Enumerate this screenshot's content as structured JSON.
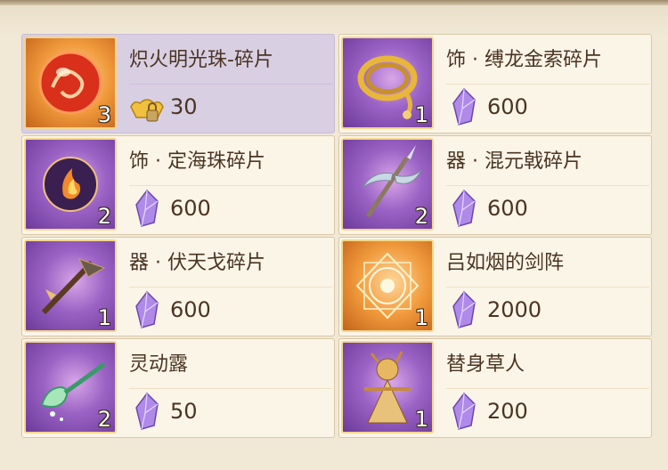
{
  "items": [
    {
      "name": "炽火明光珠-碎片",
      "quantity": "3",
      "price": "30",
      "currency_icon": "gold-ingot-lock-icon",
      "item_icon": "fire-orb-icon",
      "frame": "orange",
      "selected": true
    },
    {
      "name": "饰 · 缚龙金索碎片",
      "quantity": "1",
      "price": "600",
      "currency_icon": "purple-crystal-icon",
      "item_icon": "golden-rope-icon",
      "frame": "purple",
      "selected": false
    },
    {
      "name": "饰 · 定海珠碎片",
      "quantity": "2",
      "price": "600",
      "currency_icon": "purple-crystal-icon",
      "item_icon": "flame-pearl-icon",
      "frame": "purple",
      "selected": false
    },
    {
      "name": "器 · 混元戟碎片",
      "quantity": "2",
      "price": "600",
      "currency_icon": "purple-crystal-icon",
      "item_icon": "halberd-icon",
      "frame": "purple",
      "selected": false
    },
    {
      "name": "器 · 伏天戈碎片",
      "quantity": "1",
      "price": "600",
      "currency_icon": "purple-crystal-icon",
      "item_icon": "dagger-axe-icon",
      "frame": "purple",
      "selected": false
    },
    {
      "name": "吕如烟的剑阵",
      "quantity": "1",
      "price": "2000",
      "currency_icon": "purple-crystal-icon",
      "item_icon": "sword-formation-icon",
      "frame": "orange",
      "selected": false
    },
    {
      "name": "灵动露",
      "quantity": "2",
      "price": "50",
      "currency_icon": "purple-crystal-icon",
      "item_icon": "spirit-dew-spoon-icon",
      "frame": "purple",
      "selected": false
    },
    {
      "name": "替身草人",
      "quantity": "1",
      "price": "200",
      "currency_icon": "purple-crystal-icon",
      "item_icon": "straw-doll-icon",
      "frame": "purple",
      "selected": false
    }
  ]
}
